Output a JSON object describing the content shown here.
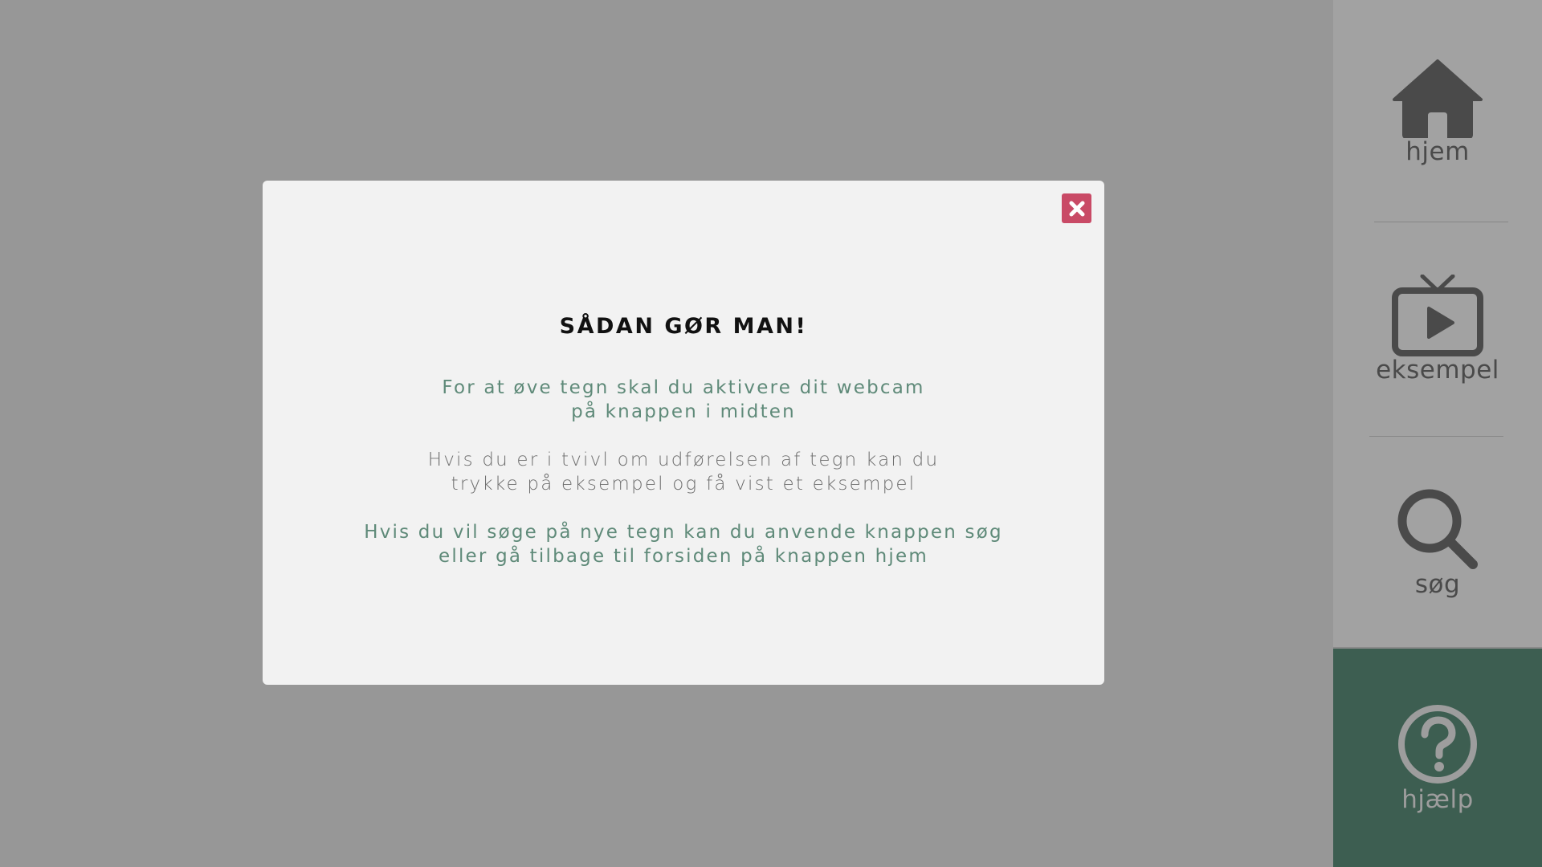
{
  "modal": {
    "title": "SÅDAN GØR MAN!",
    "paragraphs": [
      {
        "line1": "For at øve tegn skal du aktivere dit webcam",
        "line2": "på knappen i midten"
      },
      {
        "line1": "Hvis du er i tvivl om udførelsen af tegn kan du",
        "line2": "trykke på eksempel og få vist et eksempel"
      },
      {
        "line1": "Hvis du vil søge på nye tegn kan du anvende knappen søg",
        "line2": "eller gå tilbage til forsiden på knappen hjem"
      }
    ],
    "close_icon": "close-icon"
  },
  "sidebar": {
    "items": [
      {
        "label": "hjem",
        "icon": "home-icon"
      },
      {
        "label": "eksempel",
        "icon": "tv-play-icon"
      },
      {
        "label": "søg",
        "icon": "search-icon"
      },
      {
        "label": "hjælp",
        "icon": "help-icon",
        "active": true
      }
    ]
  },
  "colors": {
    "backdrop": "#979797",
    "sidebar": "#a2a2a2",
    "active_nav": "#3d5e51",
    "close_button": "#c94a66",
    "accent_text": "#5f8a79"
  }
}
